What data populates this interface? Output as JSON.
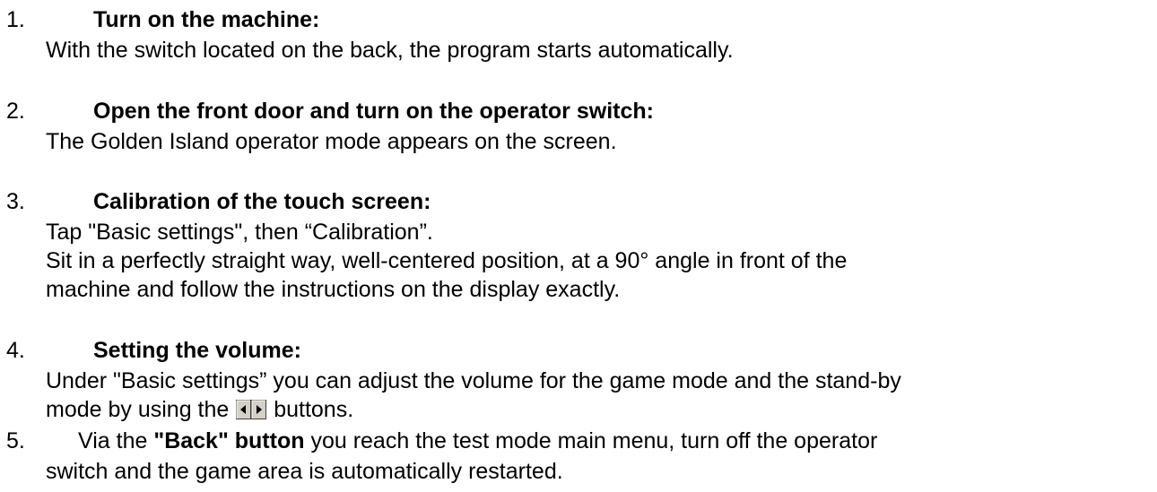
{
  "steps": [
    {
      "number": "1.",
      "heading": "Turn on the machine:",
      "lines": [
        "With the switch located on the back, the program starts automatically."
      ]
    },
    {
      "number": "2.",
      "heading": "Open the front door and turn on the operator switch:",
      "lines": [
        "The Golden Island operator mode appears on the screen."
      ]
    },
    {
      "number": "3.",
      "heading": "Calibration of the touch screen:",
      "lines": [
        "Tap \"Basic settings\", then “Calibration”.",
        "Sit in a perfectly straight way, well-centered position, at a 90° angle in front of the",
        "machine and follow the instructions on the display exactly."
      ]
    },
    {
      "number": "4.",
      "heading": "Setting the volume:",
      "lines": [
        "Under \"Basic settings” you can adjust the volume for the game mode and the stand-by",
        "mode by using the",
        "buttons."
      ],
      "icon": "left-right-arrow-buttons-icon"
    },
    {
      "number": "5.",
      "lead": "Via the",
      "bold_text": "\"Back\" button",
      "lines": [
        "you reach the test mode main menu, turn off the operator",
        "switch and the game area is automatically restarted."
      ]
    }
  ]
}
